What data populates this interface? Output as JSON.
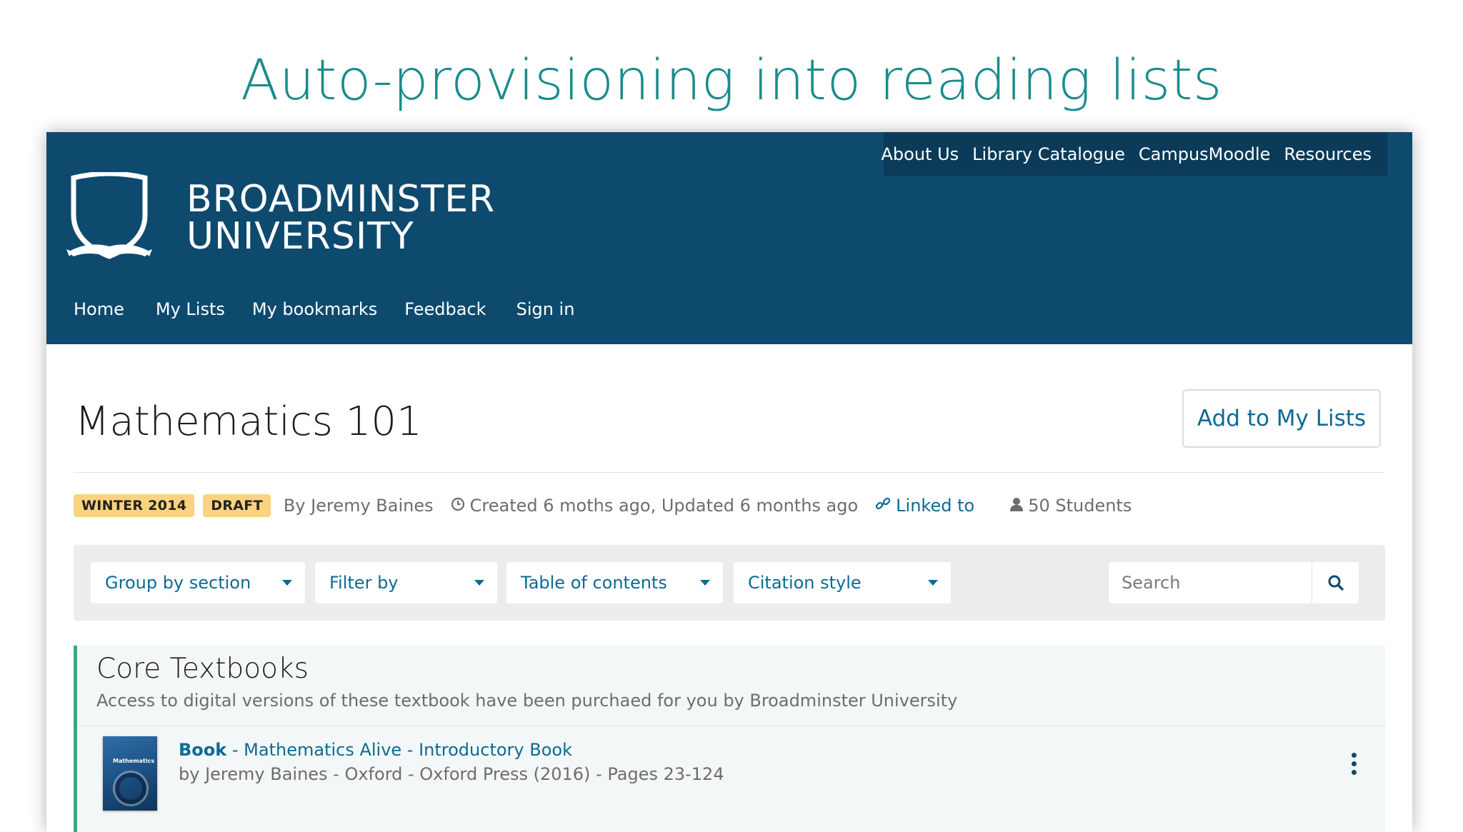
{
  "slide": {
    "title": "Auto-provisioning into reading lists"
  },
  "header": {
    "utility_links": [
      "About Us",
      "Library Catalogue",
      "CampusMoodle",
      "Resources"
    ],
    "logo": {
      "line1": "BROADMINSTER",
      "line2": "UNIVERSITY"
    },
    "nav": [
      "Home",
      "My Lists",
      "My bookmarks",
      "Feedback",
      "Sign in"
    ]
  },
  "list": {
    "title": "Mathematics 101",
    "add_button": "Add to My Lists",
    "badges": [
      "WINTER 2014",
      "DRAFT"
    ],
    "author": "By Jeremy Baines",
    "dates": "Created 6 moths ago,  Updated 6 months ago",
    "linked": "Linked to",
    "students": "50 Students"
  },
  "toolbar": {
    "group_by": "Group by section",
    "filter_by": "Filter by",
    "table_of_contents": "Table of contents",
    "citation_style": "Citation style",
    "search_placeholder": "Search"
  },
  "section": {
    "title": "Core Textbooks",
    "description": "Access to digital versions of these textbook have been purchaed for you by Broadminster University",
    "items": [
      {
        "type": "Book",
        "title": " - Mathematics Alive - Introductory Book",
        "details": "by Jeremy Baines - Oxford - Oxford Press (2016) - Pages 23-124",
        "cover_text": "Mathematics"
      }
    ]
  },
  "colors": {
    "brand": "#0e4a6e",
    "brand_dark": "#0b3b59",
    "accent_link": "#0e6a94",
    "title_teal": "#1a8c8c",
    "badge": "#fbd27f",
    "section_border": "#3aa87c"
  },
  "icons": [
    "shield-crest-icon",
    "clock-icon",
    "link-icon",
    "user-icon",
    "caret-down-icon",
    "search-icon",
    "more-vertical-icon"
  ]
}
